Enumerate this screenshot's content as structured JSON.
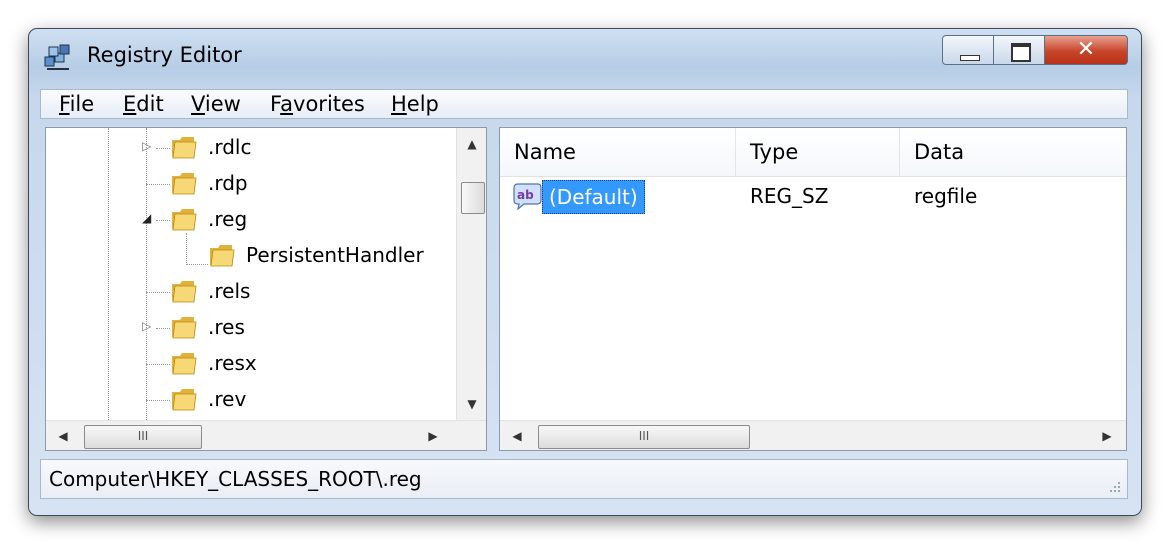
{
  "window": {
    "title": "Registry Editor",
    "close_glyph": "✕"
  },
  "menu": [
    {
      "label": "File",
      "key": "F",
      "rest": "ile"
    },
    {
      "label": "Edit",
      "key": "E",
      "rest": "dit"
    },
    {
      "label": "View",
      "key": "V",
      "rest": "iew"
    },
    {
      "label": "Favorites",
      "pre": "F",
      "key": "a",
      "rest": "vorites"
    },
    {
      "label": "Help",
      "key": "H",
      "rest": "elp"
    }
  ],
  "tree": {
    "items": [
      {
        "label": ".rdlc",
        "expander": "collapsed"
      },
      {
        "label": ".rdp",
        "expander": "none"
      },
      {
        "label": ".reg",
        "expander": "expanded"
      },
      {
        "label": "PersistentHandler",
        "expander": "none",
        "child": true
      },
      {
        "label": ".rels",
        "expander": "none"
      },
      {
        "label": ".res",
        "expander": "collapsed"
      },
      {
        "label": ".resx",
        "expander": "none"
      },
      {
        "label": ".rev",
        "expander": "none"
      }
    ],
    "scroll_up": "▲",
    "scroll_down": "▼",
    "scroll_left": "◀",
    "scroll_right": "▶",
    "thumb_grip": "III"
  },
  "list": {
    "columns": {
      "name": "Name",
      "type": "Type",
      "data": "Data"
    },
    "rows": [
      {
        "name": "(Default)",
        "type": "REG_SZ",
        "data": "regfile",
        "icon": "ab"
      }
    ],
    "scroll_left": "◀",
    "scroll_right": "▶",
    "thumb_grip": "III"
  },
  "status": {
    "path": "Computer\\HKEY_CLASSES_ROOT\\.reg"
  },
  "colors": {
    "selection": "#3399ff",
    "folder": "#f2c94c",
    "close": "#c8452a"
  }
}
